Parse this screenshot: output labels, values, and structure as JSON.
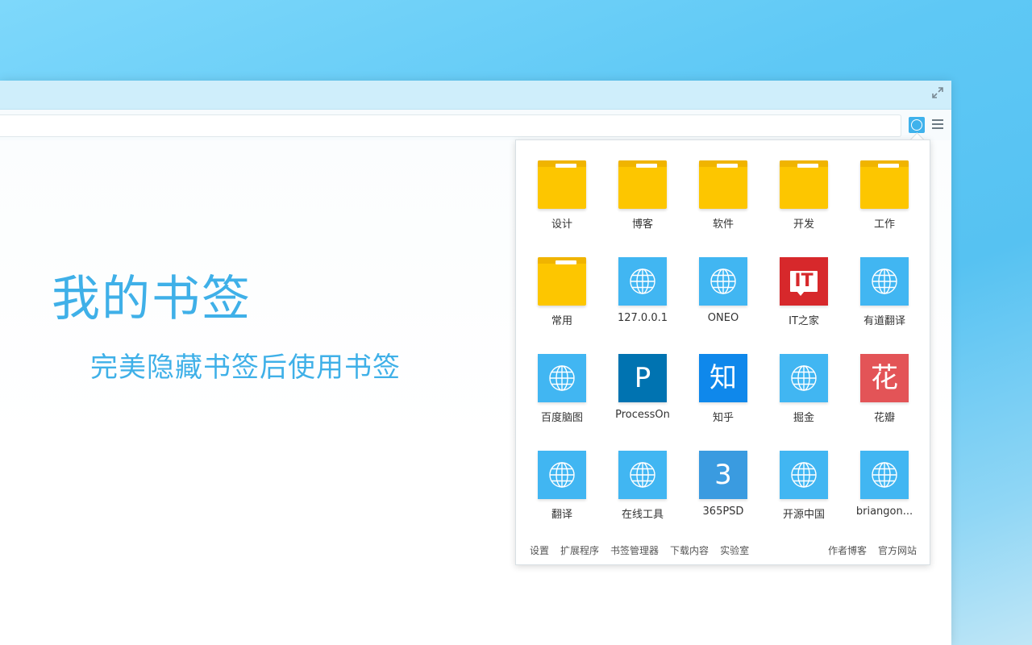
{
  "colors": {
    "accent": "#3fb0e8",
    "folder": "#fdc600",
    "web_tile": "#41b6f2",
    "ithome": "#d7282b",
    "processon": "#0073b1",
    "zhihu": "#0f88eb",
    "huaban": "#e35457",
    "psd365": "#3a9be0"
  },
  "hero": {
    "title": "我的书签",
    "subtitle": "完美隐藏书签后使用书签"
  },
  "bookmarks": [
    {
      "label": "设计",
      "kind": "folder"
    },
    {
      "label": "博客",
      "kind": "folder"
    },
    {
      "label": "软件",
      "kind": "folder"
    },
    {
      "label": "开发",
      "kind": "folder"
    },
    {
      "label": "工作",
      "kind": "folder"
    },
    {
      "label": "常用",
      "kind": "folder"
    },
    {
      "label": "127.0.0.1",
      "kind": "web"
    },
    {
      "label": "ONEO",
      "kind": "web"
    },
    {
      "label": "IT之家",
      "kind": "ithome",
      "glyph": "IT"
    },
    {
      "label": "有道翻译",
      "kind": "web"
    },
    {
      "label": "百度脑图",
      "kind": "web"
    },
    {
      "label": "ProcessOn",
      "kind": "letter",
      "glyph": "P",
      "color": "#0073b1"
    },
    {
      "label": "知乎",
      "kind": "letter",
      "glyph": "知",
      "color": "#0f88eb"
    },
    {
      "label": "掘金",
      "kind": "web"
    },
    {
      "label": "花瓣",
      "kind": "letter",
      "glyph": "花",
      "color": "#e35457"
    },
    {
      "label": "翻译",
      "kind": "web"
    },
    {
      "label": "在线工具",
      "kind": "web"
    },
    {
      "label": "365PSD",
      "kind": "letter",
      "glyph": "3",
      "color": "#3a9be0"
    },
    {
      "label": "开源中国",
      "kind": "web"
    },
    {
      "label": "briangon...",
      "kind": "web"
    }
  ],
  "footer": {
    "left": [
      "设置",
      "扩展程序",
      "书签管理器",
      "下载内容",
      "实验室"
    ],
    "right": [
      "作者博客",
      "官方网站"
    ]
  },
  "icons": {
    "maximize": "expand-icon",
    "extension": "bookmark-extension-icon",
    "menu": "menu-icon",
    "web": "globe-icon",
    "folder": "folder-icon"
  }
}
